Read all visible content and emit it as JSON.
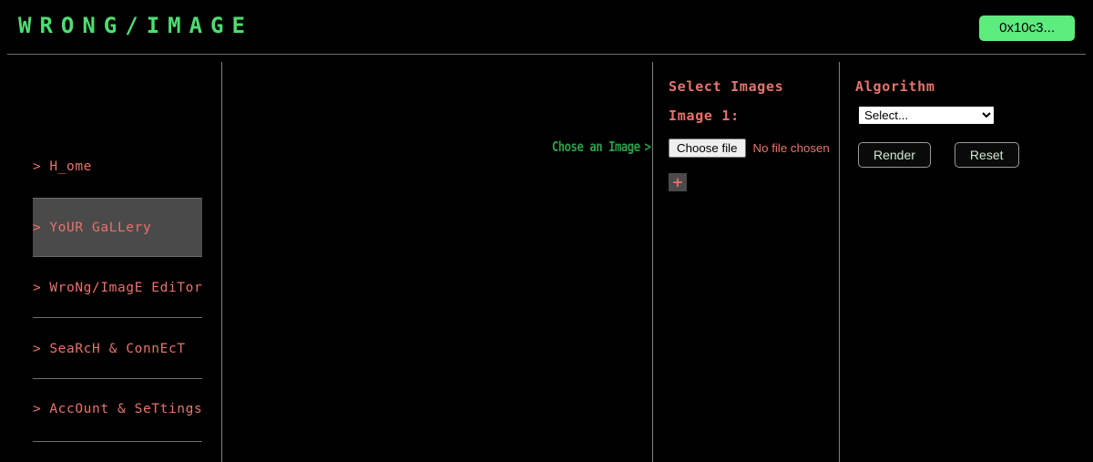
{
  "header": {
    "brand": "WRONG/IMAGE",
    "wallet_label": "0x10c3...",
    "brand_color": "#4ddd72",
    "wallet_bg": "#5dec7e"
  },
  "sidebar": {
    "caret": ">",
    "items": [
      {
        "label": "H_ome",
        "active": false
      },
      {
        "label": "YoUR GaLLery",
        "active": true
      },
      {
        "label": "WroNg/ImagE EdiTor",
        "active": false
      },
      {
        "label": "SeaRcH & ConnEcT",
        "active": false
      },
      {
        "label": "AccOunt & SeTtings",
        "active": false
      }
    ],
    "accent_color": "#e8736c"
  },
  "center": {
    "choose_image_label": "Chose an Image",
    "choose_image_arrow": ">",
    "link_color": "#2f9e4a"
  },
  "select_images": {
    "heading": "Select Images",
    "image_label": "Image 1:",
    "choose_file_button": "Choose file",
    "no_file_text": "No file chosen",
    "add_button": "+"
  },
  "algorithm": {
    "heading": "Algorithm",
    "select_value": "Select...",
    "options": [
      "Select..."
    ],
    "render_label": "Render",
    "reset_label": "Reset"
  }
}
